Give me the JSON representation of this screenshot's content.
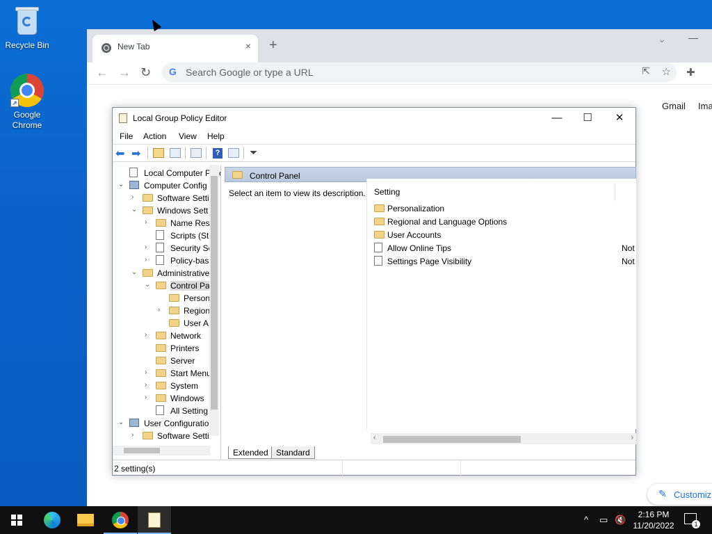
{
  "desktop": {
    "icons": [
      {
        "label": "Recycle Bin",
        "icon": "recycle-bin-icon"
      },
      {
        "label": "Google Chrome",
        "icon": "chrome-icon"
      }
    ]
  },
  "browser": {
    "tab_title": "New Tab",
    "tab_close": "×",
    "new_tab": "+",
    "omnibox_placeholder": "Search Google or type a URL",
    "omnibox_g": "G",
    "back": "←",
    "forward": "→",
    "reload": "↻",
    "star": "☆",
    "share": "⇱",
    "extensions": "✚",
    "tab_search": "⌄",
    "minimize": "—",
    "gmail": "Gmail",
    "images": "Ima",
    "customize": "Customiz",
    "customize_icon": "✎"
  },
  "gpedit": {
    "title": "Local Group Policy Editor",
    "controls": {
      "minimize": "—",
      "maximize": "☐",
      "close": "✕"
    },
    "menu": [
      "File",
      "Action",
      "View",
      "Help"
    ],
    "tree": [
      {
        "label": "Local Computer Polic",
        "icon": "doc",
        "level": 0,
        "exp": ""
      },
      {
        "label": "Computer Config",
        "icon": "pc",
        "level": 0,
        "exp": "v"
      },
      {
        "label": "Software Setti",
        "icon": "folder",
        "level": 1,
        "exp": ">"
      },
      {
        "label": "Windows Sett",
        "icon": "folder",
        "level": 1,
        "exp": "v"
      },
      {
        "label": "Name Res",
        "icon": "folder",
        "level": 2,
        "exp": ">"
      },
      {
        "label": "Scripts (Sta",
        "icon": "doc",
        "level": 2,
        "exp": ""
      },
      {
        "label": "Security Se",
        "icon": "doc",
        "level": 2,
        "exp": ">"
      },
      {
        "label": "Policy-bas",
        "icon": "doc",
        "level": 2,
        "exp": ">"
      },
      {
        "label": "Administrative",
        "icon": "folder",
        "level": 1,
        "exp": "v"
      },
      {
        "label": "Control Pa",
        "icon": "folder",
        "level": 2,
        "exp": "v",
        "selected": true
      },
      {
        "label": "Person",
        "icon": "folder",
        "level": 3,
        "exp": ""
      },
      {
        "label": "Region",
        "icon": "folder",
        "level": 3,
        "exp": ">"
      },
      {
        "label": "User A",
        "icon": "folder",
        "level": 3,
        "exp": ""
      },
      {
        "label": "Network",
        "icon": "folder",
        "level": 2,
        "exp": ">"
      },
      {
        "label": "Printers",
        "icon": "folder",
        "level": 2,
        "exp": ""
      },
      {
        "label": "Server",
        "icon": "folder",
        "level": 2,
        "exp": ""
      },
      {
        "label": "Start Menu",
        "icon": "folder",
        "level": 2,
        "exp": ">"
      },
      {
        "label": "System",
        "icon": "folder",
        "level": 2,
        "exp": ">"
      },
      {
        "label": "Windows",
        "icon": "folder",
        "level": 2,
        "exp": ">"
      },
      {
        "label": "All Setting",
        "icon": "doc",
        "level": 2,
        "exp": ""
      },
      {
        "label": "User Configuratio",
        "icon": "pc",
        "level": 0,
        "exp": "v"
      },
      {
        "label": "Software Setti",
        "icon": "folder",
        "level": 1,
        "exp": ">"
      }
    ],
    "header": "Control Panel",
    "description": "Select an item to view its description.",
    "column_setting": "Setting",
    "items": [
      {
        "label": "Personalization",
        "icon": "folder",
        "state": ""
      },
      {
        "label": "Regional and Language Options",
        "icon": "folder",
        "state": ""
      },
      {
        "label": "User Accounts",
        "icon": "folder",
        "state": ""
      },
      {
        "label": "Allow Online Tips",
        "icon": "doc",
        "state": "Not"
      },
      {
        "label": "Settings Page Visibility",
        "icon": "doc",
        "state": "Not"
      }
    ],
    "tab_extended": "Extended",
    "tab_standard": "Standard",
    "status": "2 setting(s)"
  },
  "taskbar": {
    "clock_time": "2:16 PM",
    "clock_date": "11/20/2022",
    "tray_chevron": "^",
    "tray_network": "▭",
    "tray_sound": "🔇",
    "notifications_count": "1"
  }
}
